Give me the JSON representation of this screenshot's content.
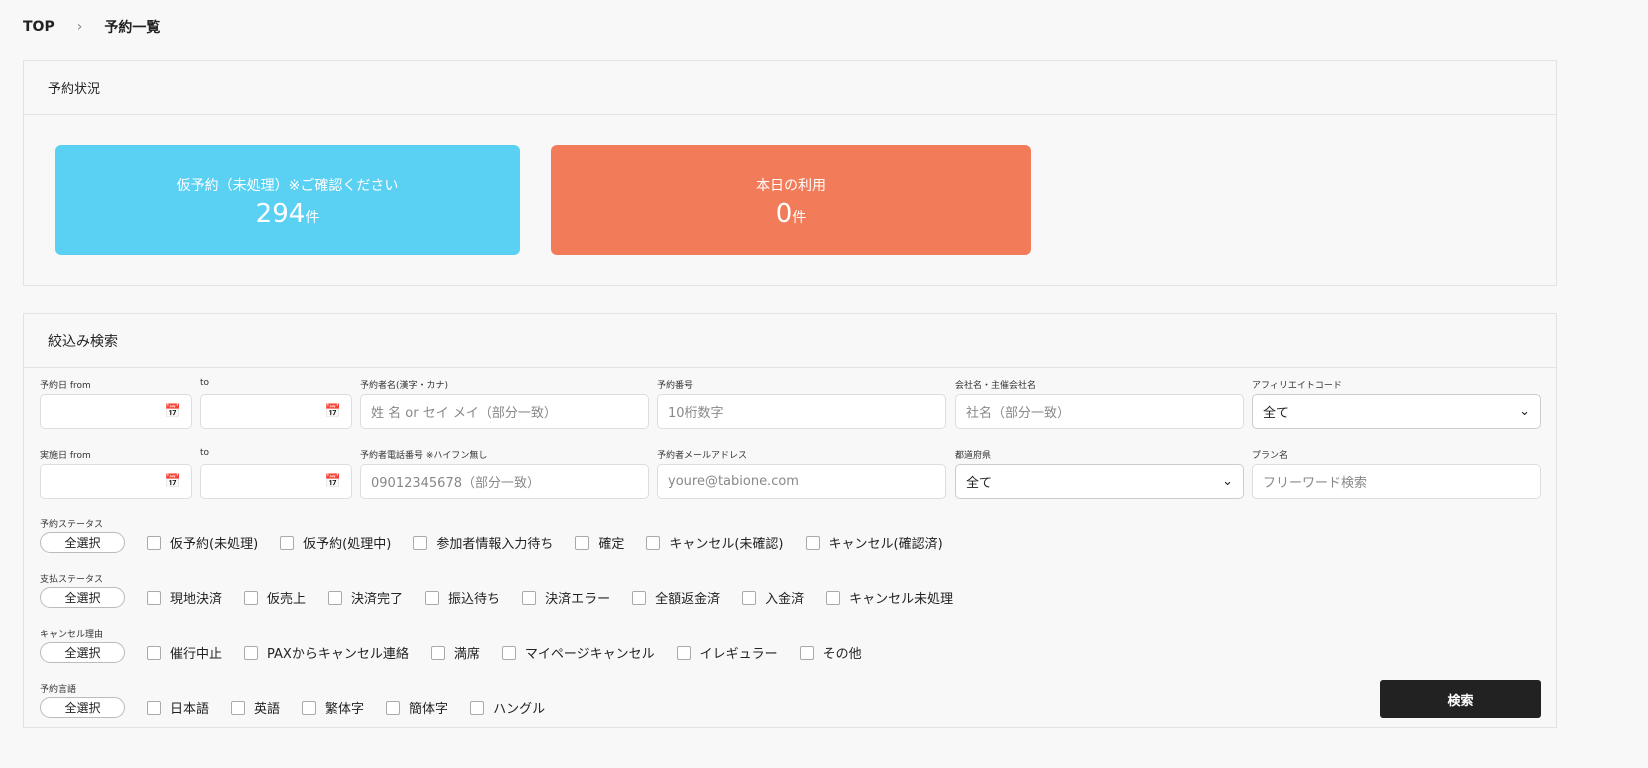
{
  "breadcrumb": {
    "top": "TOP",
    "current": "予約一覧"
  },
  "status": {
    "title": "予約状況",
    "pending": {
      "label": "仮予約（未処理）※ご確認ください",
      "count": "294",
      "unit": "件",
      "color": "#5ad0f3"
    },
    "today": {
      "label": "本日の利用",
      "count": "0",
      "unit": "件",
      "color": "#f27c59"
    }
  },
  "filter": {
    "title": "絞込み検索",
    "fields": {
      "res_from": {
        "label": "予約日 from"
      },
      "res_to": {
        "label": "to"
      },
      "name": {
        "label": "予約者名(漢字・カナ)",
        "placeholder": "姓 名 or セイ メイ（部分一致）"
      },
      "number": {
        "label": "予約番号",
        "placeholder": "10桁数字"
      },
      "company": {
        "label": "会社名・主催会社名",
        "placeholder": "社名（部分一致）"
      },
      "affiliate": {
        "label": "アフィリエイトコード",
        "value": "全て"
      },
      "exec_from": {
        "label": "実施日 from"
      },
      "exec_to": {
        "label": "to"
      },
      "phone": {
        "label": "予約者電話番号 ※ハイフン無し",
        "placeholder": "09012345678（部分一致）"
      },
      "email": {
        "label": "予約者メールアドレス",
        "placeholder": "youre@tabione.com"
      },
      "pref": {
        "label": "都道府県",
        "value": "全て"
      },
      "plan": {
        "label": "プラン名",
        "placeholder": "フリーワード検索"
      }
    },
    "select_all": "全選択",
    "groups": [
      {
        "label": "予約ステータス",
        "options": [
          "仮予約(未処理)",
          "仮予約(処理中)",
          "参加者情報入力待ち",
          "確定",
          "キャンセル(未確認)",
          "キャンセル(確認済)"
        ]
      },
      {
        "label": "支払ステータス",
        "options": [
          "現地決済",
          "仮売上",
          "決済完了",
          "振込待ち",
          "決済エラー",
          "全額返金済",
          "入金済",
          "キャンセル未処理"
        ]
      },
      {
        "label": "キャンセル理由",
        "options": [
          "催行中止",
          "PAXからキャンセル連絡",
          "満席",
          "マイページキャンセル",
          "イレギュラー",
          "その他"
        ]
      },
      {
        "label": "予約言語",
        "options": [
          "日本語",
          "英語",
          "繁体字",
          "簡体字",
          "ハングル"
        ]
      }
    ],
    "search_button": "検索"
  }
}
